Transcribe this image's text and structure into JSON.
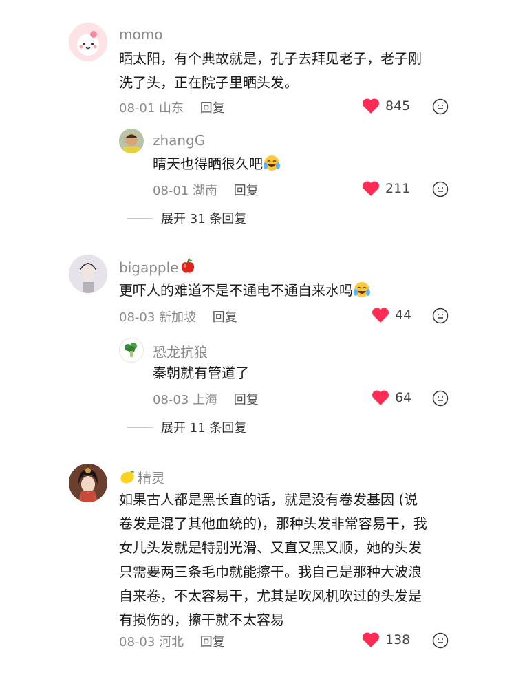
{
  "comments": [
    {
      "user": "momo",
      "lines": [
        "晒太阳，有个典故就是，孔子去拜见老子，老子刚",
        "洗了头，正在院子里晒头发。"
      ],
      "date": "08-01",
      "location": "山东",
      "reply_label": "回复",
      "likes": "845",
      "replies": [
        {
          "user": "zhangG",
          "text": "晴天也得晒很久吧",
          "date": "08-01",
          "location": "湖南",
          "reply_label": "回复",
          "likes": "211"
        }
      ],
      "expand": "展开 31 条回复"
    },
    {
      "user": "bigapple",
      "lines": [
        "更吓人的难道不是不通电不通自来水吗"
      ],
      "date": "08-03",
      "location": "新加坡",
      "reply_label": "回复",
      "likes": "44",
      "replies": [
        {
          "user": "恐龙抗狼",
          "text": "秦朝就有管道了",
          "date": "08-03",
          "location": "上海",
          "reply_label": "回复",
          "likes": "64"
        }
      ],
      "expand": "展开 11 条回复"
    },
    {
      "user": "精灵",
      "lines": [
        "如果古人都是黑长直的话，就是没有卷发基因 (说",
        "卷发是混了其他血统的)，那种头发非常容易干，我",
        "女儿头发就是特别光滑、又直又黑又顺，她的头发",
        "只需要两三条毛巾就能擦干。我自己是那种大波浪",
        "自来卷，不太容易干，尤其是吹风机吹过的头发是",
        "有损伤的，擦干就不太容易"
      ],
      "date": "08-03",
      "location": "河北",
      "reply_label": "回复",
      "likes": "138"
    }
  ],
  "colors": {
    "heart": "#fe2c55",
    "muted": "#8a8a8a",
    "text": "#1a1a1a"
  },
  "icons": {
    "like": "heart-icon",
    "more": "emoji-face-icon",
    "apple": "apple-emoji",
    "lemon": "lemon-emoji",
    "cry": "crying-laughing-emoji"
  }
}
